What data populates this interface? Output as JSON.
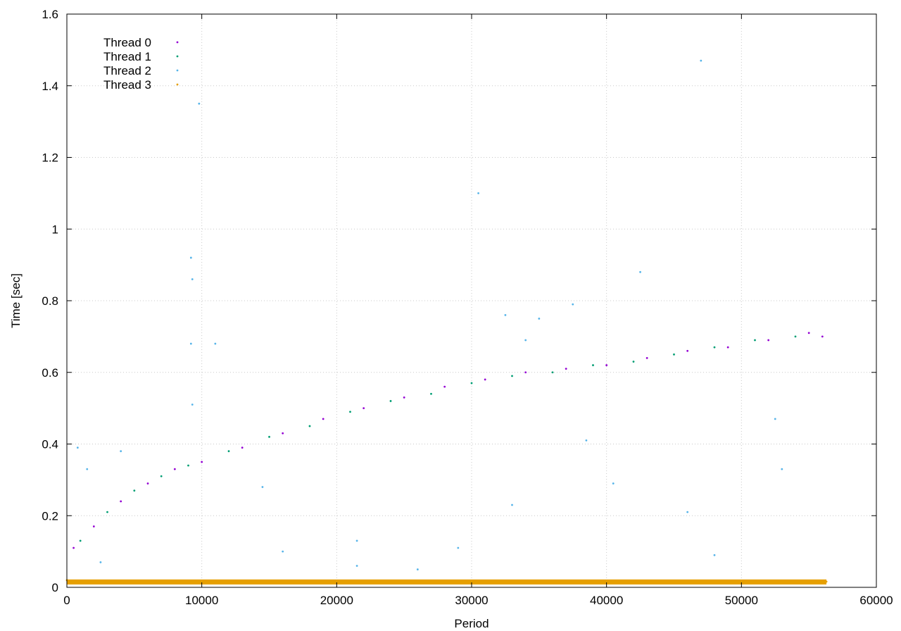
{
  "chart_data": {
    "type": "scatter",
    "title": "",
    "xlabel": "Period",
    "ylabel": "Time [sec]",
    "xlim": [
      0,
      60000
    ],
    "ylim": [
      0,
      1.6
    ],
    "x_ticks": [
      "0",
      "10000",
      "20000",
      "30000",
      "40000",
      "50000",
      "60000"
    ],
    "y_ticks": [
      "0",
      "0.2",
      "0.4",
      "0.6",
      "0.8",
      "1",
      "1.2",
      "1.4",
      "1.6"
    ],
    "grid": true,
    "legend_position": "top-left",
    "series": [
      {
        "name": "Thread 0",
        "color": "#9400d3",
        "points": [
          [
            500,
            0.11
          ],
          [
            2000,
            0.17
          ],
          [
            4000,
            0.24
          ],
          [
            6000,
            0.29
          ],
          [
            8000,
            0.33
          ],
          [
            10000,
            0.35
          ],
          [
            13000,
            0.39
          ],
          [
            16000,
            0.43
          ],
          [
            19000,
            0.47
          ],
          [
            22000,
            0.5
          ],
          [
            25000,
            0.53
          ],
          [
            28000,
            0.56
          ],
          [
            31000,
            0.58
          ],
          [
            34000,
            0.6
          ],
          [
            37000,
            0.61
          ],
          [
            40000,
            0.62
          ],
          [
            43000,
            0.64
          ],
          [
            46000,
            0.66
          ],
          [
            49000,
            0.67
          ],
          [
            52000,
            0.69
          ],
          [
            55000,
            0.71
          ],
          [
            56000,
            0.7
          ]
        ]
      },
      {
        "name": "Thread 1",
        "color": "#009e73",
        "points": [
          [
            1000,
            0.13
          ],
          [
            3000,
            0.21
          ],
          [
            5000,
            0.27
          ],
          [
            7000,
            0.31
          ],
          [
            9000,
            0.34
          ],
          [
            12000,
            0.38
          ],
          [
            15000,
            0.42
          ],
          [
            18000,
            0.45
          ],
          [
            21000,
            0.49
          ],
          [
            24000,
            0.52
          ],
          [
            27000,
            0.54
          ],
          [
            30000,
            0.57
          ],
          [
            33000,
            0.59
          ],
          [
            36000,
            0.6
          ],
          [
            39000,
            0.62
          ],
          [
            42000,
            0.63
          ],
          [
            45000,
            0.65
          ],
          [
            48000,
            0.67
          ],
          [
            51000,
            0.69
          ],
          [
            54000,
            0.7
          ]
        ]
      },
      {
        "name": "Thread 2",
        "color": "#56b4e9",
        "points": [
          [
            9200,
            0.92
          ],
          [
            9300,
            0.86
          ],
          [
            9200,
            0.68
          ],
          [
            9300,
            0.51
          ],
          [
            9800,
            1.35
          ],
          [
            11000,
            0.68
          ],
          [
            30500,
            1.1
          ],
          [
            32500,
            0.76
          ],
          [
            35000,
            0.75
          ],
          [
            37500,
            0.79
          ],
          [
            42500,
            0.88
          ],
          [
            47000,
            1.47
          ],
          [
            34000,
            0.69
          ],
          [
            21500,
            0.13
          ],
          [
            21500,
            0.06
          ],
          [
            4000,
            0.38
          ],
          [
            800,
            0.39
          ],
          [
            16000,
            0.1
          ],
          [
            26000,
            0.05
          ],
          [
            33000,
            0.23
          ],
          [
            46000,
            0.21
          ],
          [
            52500,
            0.47
          ],
          [
            53000,
            0.33
          ],
          [
            40500,
            0.29
          ],
          [
            1500,
            0.33
          ],
          [
            38500,
            0.41
          ],
          [
            14500,
            0.28
          ],
          [
            29000,
            0.11
          ],
          [
            48000,
            0.09
          ],
          [
            2500,
            0.07
          ]
        ]
      },
      {
        "name": "Thread 3",
        "color": "#e69f00",
        "points": [
          [
            0,
            0.02
          ],
          [
            2000,
            0.015
          ],
          [
            5000,
            0.016
          ],
          [
            10000,
            0.016
          ],
          [
            15000,
            0.017
          ],
          [
            20000,
            0.016
          ],
          [
            25000,
            0.016
          ],
          [
            30000,
            0.017
          ],
          [
            35000,
            0.017
          ],
          [
            40000,
            0.016
          ],
          [
            45000,
            0.017
          ],
          [
            50000,
            0.016
          ],
          [
            55000,
            0.017
          ],
          [
            56300,
            0.016
          ]
        ]
      }
    ]
  }
}
